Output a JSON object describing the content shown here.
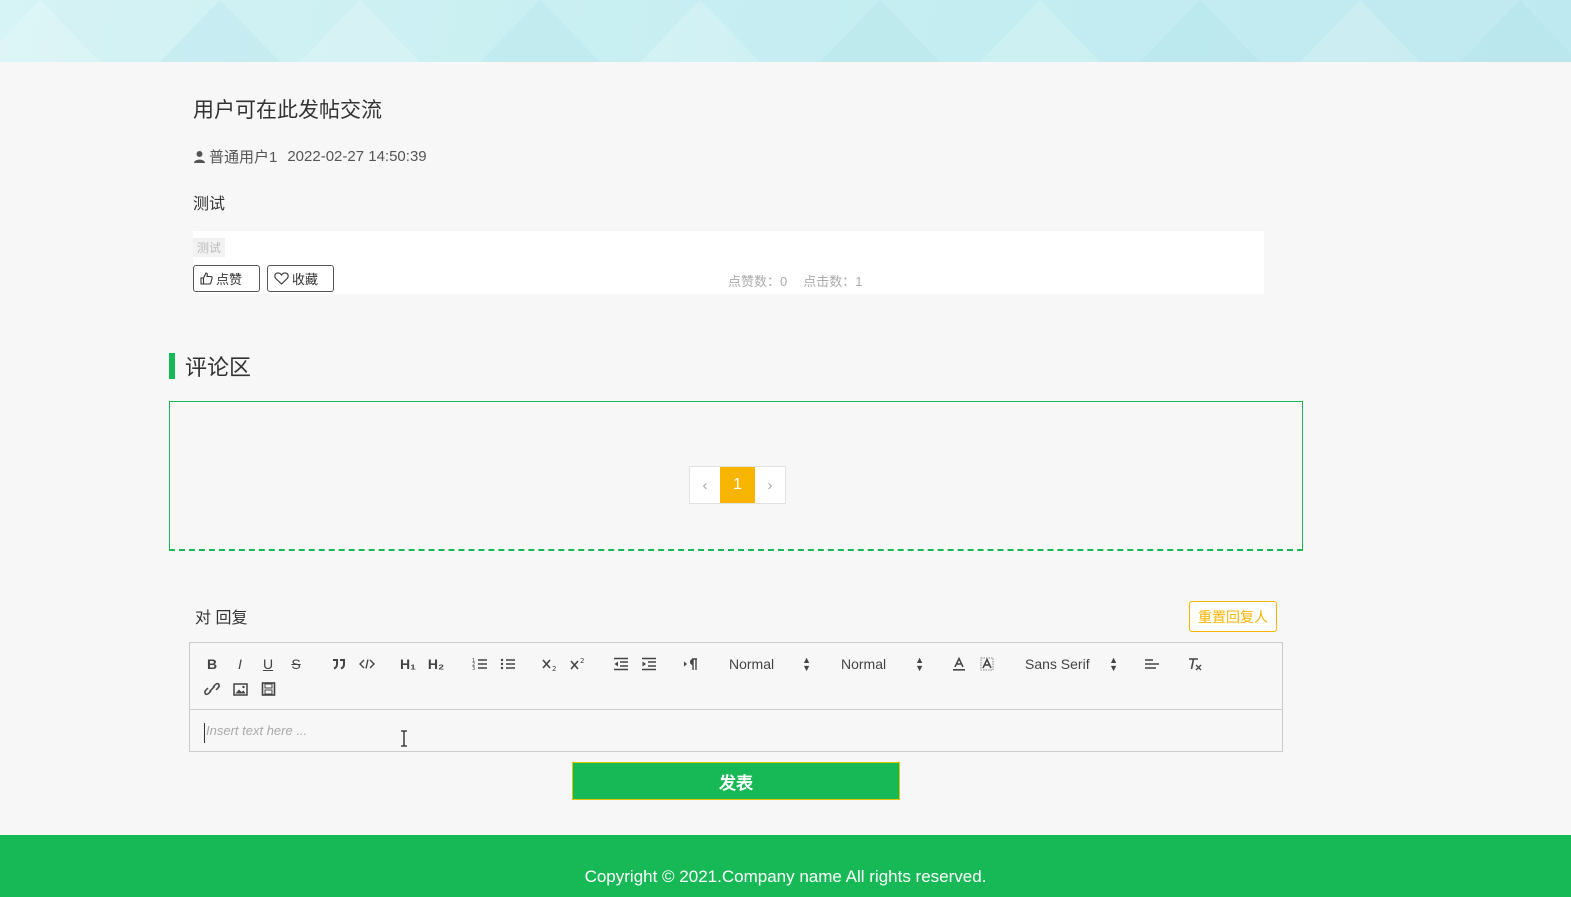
{
  "post": {
    "title": "用户可在此发帖交流",
    "author": "普通用户1",
    "date": "2022-02-27 14:50:39",
    "body": "测试",
    "tag": "测试",
    "like_label": "点赞",
    "favorite_label": "收藏",
    "likes_text": "点赞数：0",
    "clicks_text": "点击数：1"
  },
  "comments": {
    "section_title": "评论区",
    "pager": {
      "prev": "‹",
      "current": "1",
      "next": "›"
    }
  },
  "reply": {
    "label": "对 回复",
    "reset_label": "重置回复人",
    "toolbar": {
      "bold": "B",
      "italic": "I",
      "underline": "U",
      "strike": "S",
      "h1": "H₁",
      "h2": "H₂",
      "header_picker": "Normal",
      "size_picker": "Normal",
      "font_picker": "Sans Serif"
    },
    "placeholder": "Insert text here ...",
    "submit_label": "发表"
  },
  "footer": {
    "copyright": "Copyright © 2021.Company name All rights reserved."
  },
  "colors": {
    "accent": "#17b856",
    "highlight": "#f7b500"
  }
}
